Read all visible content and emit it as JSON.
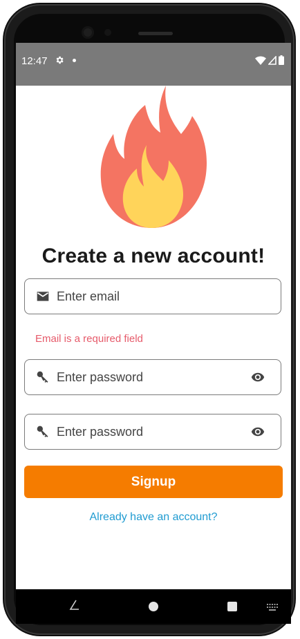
{
  "status": {
    "time": "12:47"
  },
  "signup": {
    "title": "Create a new account!",
    "email_placeholder": "Enter email",
    "email_error": "Email is a required field",
    "password_placeholder": "Enter password",
    "confirm_password_placeholder": "Enter password",
    "button_label": "Signup",
    "login_link": "Already have an account?"
  },
  "icons": {
    "status": [
      "gear-icon",
      "notification-dot-icon",
      "wifi-icon",
      "cellular-icon",
      "battery-icon"
    ],
    "email_field": "mail-icon",
    "password_field": "key-icon",
    "password_toggle": "eye-icon",
    "logo": "flame-icon",
    "nav": [
      "back-icon",
      "home-icon",
      "recents-icon",
      "keyboard-icon"
    ]
  },
  "colors": {
    "accent": "#f57c00",
    "link": "#1f9bd1",
    "error": "#e65a6a",
    "status_bar": "#7a7a7a",
    "flame_outer": "#f47462",
    "flame_inner": "#ffd45a"
  }
}
